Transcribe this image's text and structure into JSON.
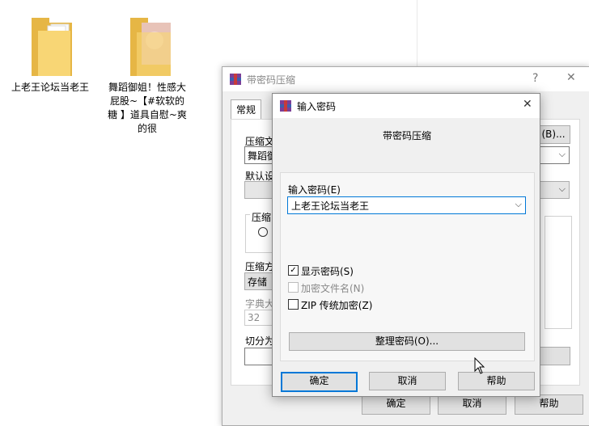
{
  "desktop": {
    "icon1_label": "上老王论坛当老王",
    "icon2_label": "舞蹈御姐！性感大屁股~【#软软的糖 】道具自慰~爽的很"
  },
  "back_dialog": {
    "title": "带密码压缩",
    "help_glyph": "?",
    "close_glyph": "✕",
    "tab_general": "常规",
    "browse_label": "(B)...",
    "archive_name_label": "压缩文",
    "archive_name_value": "舞蹈御",
    "default_profile_label": "默认设",
    "format_label": "压缩",
    "method_label": "压缩方",
    "method_value": "存储",
    "dict_label": "字典大",
    "dict_value": "32",
    "split_label": "切分为",
    "ok_label": "确定",
    "cancel_label": "取消",
    "help_label": "帮助"
  },
  "front_dialog": {
    "title": "输入密码",
    "close_glyph": "✕",
    "subtitle": "带密码压缩",
    "password_label": "输入密码(E)",
    "password_value": "上老王论坛当老王",
    "show_password_label": "显示密码(S)",
    "show_password_checked": true,
    "encrypt_names_label": "加密文件名(N)",
    "zip_legacy_label": "ZIP 传统加密(Z)",
    "organize_label": "整理密码(O)...",
    "ok_label": "确定",
    "cancel_label": "取消",
    "help_label": "帮助"
  }
}
